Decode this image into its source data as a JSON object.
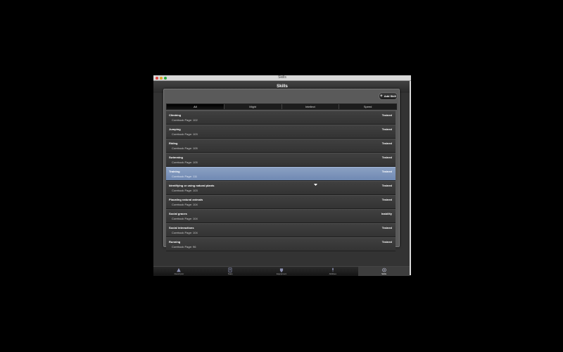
{
  "window": {
    "title": "Skills"
  },
  "header": {
    "title": "Skills"
  },
  "toolbar": {
    "add_skill_label": "Add Skill"
  },
  "segments": [
    {
      "label": "All",
      "active": true
    },
    {
      "label": "Might",
      "active": false
    },
    {
      "label": "Intellect",
      "active": false
    },
    {
      "label": "Speed",
      "active": false
    }
  ],
  "skills": [
    {
      "name": "Climbing",
      "page": "Corebook Page: 102",
      "status": "Trained",
      "selected": false
    },
    {
      "name": "Jumping",
      "page": "Corebook Page: 103",
      "status": "Trained",
      "selected": false
    },
    {
      "name": "Riding",
      "page": "Corebook Page: 105",
      "status": "Trained",
      "selected": false
    },
    {
      "name": "Swimming",
      "page": "Corebook Page: 105",
      "status": "Trained",
      "selected": false
    },
    {
      "name": "Training",
      "page": "Corebook Page: 111",
      "status": "Trained",
      "selected": true
    },
    {
      "name": "Identifying or using natural plants",
      "page": "Corebook Page: 103",
      "status": "Trained",
      "selected": false
    },
    {
      "name": "Placating natural animals",
      "page": "Corebook Page: 104",
      "status": "Trained",
      "selected": false
    },
    {
      "name": "Social graces",
      "page": "Corebook Page: 104",
      "status": "Inability",
      "selected": false
    },
    {
      "name": "Social interactions",
      "page": "Corebook Page: 104",
      "status": "Trained",
      "selected": false
    },
    {
      "name": "Running",
      "page": "Corebook Page: 96",
      "status": "Trained",
      "selected": false
    }
  ],
  "tabbar": [
    {
      "label": "Descriptor",
      "icon": "descriptor-icon",
      "active": false
    },
    {
      "label": "Stats",
      "icon": "stats-icon",
      "active": false
    },
    {
      "label": "Equipment",
      "icon": "equipment-icon",
      "active": false
    },
    {
      "label": "Abilities",
      "icon": "abilities-icon",
      "active": false
    },
    {
      "label": "Skills",
      "icon": "skills-icon",
      "active": true
    }
  ]
}
